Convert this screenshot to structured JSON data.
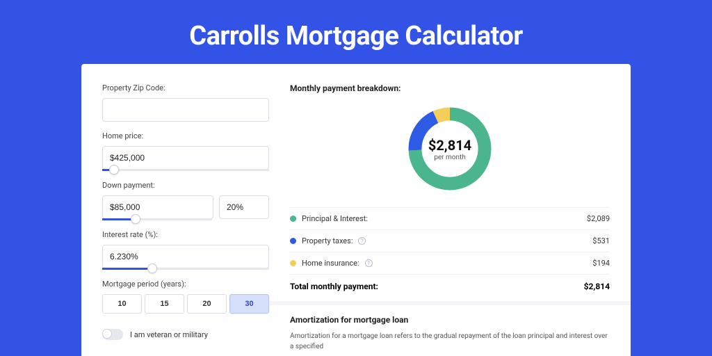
{
  "title": "Carrolls Mortgage Calculator",
  "form": {
    "zip_label": "Property Zip Code:",
    "zip_value": "",
    "home_price_label": "Home price:",
    "home_price_value": "$425,000",
    "home_price_pct": 7,
    "down_label": "Down payment:",
    "down_value": "$85,000",
    "down_pct_value": "20%",
    "down_slider_pct": 20,
    "rate_label": "Interest rate (%):",
    "rate_value": "6.230%",
    "rate_slider_pct": 30,
    "period_label": "Mortgage period (years):",
    "periods": [
      "10",
      "15",
      "20",
      "30"
    ],
    "period_selected": "30",
    "veteran_label": "I am veteran or military",
    "veteran_on": false
  },
  "breakdown": {
    "title": "Monthly payment breakdown:",
    "center_amount": "$2,814",
    "center_sub": "per month",
    "items": [
      {
        "label": "Principal & Interest:",
        "value": "$2,089",
        "color": "#4bb58e",
        "info": false
      },
      {
        "label": "Property taxes:",
        "value": "$531",
        "color": "#2e5be3",
        "info": true
      },
      {
        "label": "Home insurance:",
        "value": "$194",
        "color": "#f3cf5a",
        "info": true
      }
    ],
    "total_label": "Total monthly payment:",
    "total_value": "$2,814"
  },
  "chart_data": {
    "type": "pie",
    "title": "Monthly payment breakdown",
    "series": [
      {
        "name": "Principal & Interest",
        "value": 2089,
        "color": "#4bb58e"
      },
      {
        "name": "Property taxes",
        "value": 531,
        "color": "#2e5be3"
      },
      {
        "name": "Home insurance",
        "value": 194,
        "color": "#f3cf5a"
      }
    ],
    "total": 2814,
    "center_label": "$2,814 per month"
  },
  "amortization": {
    "title": "Amortization for mortgage loan",
    "text": "Amortization for a mortgage loan refers to the gradual repayment of the loan principal and interest over a specified"
  }
}
